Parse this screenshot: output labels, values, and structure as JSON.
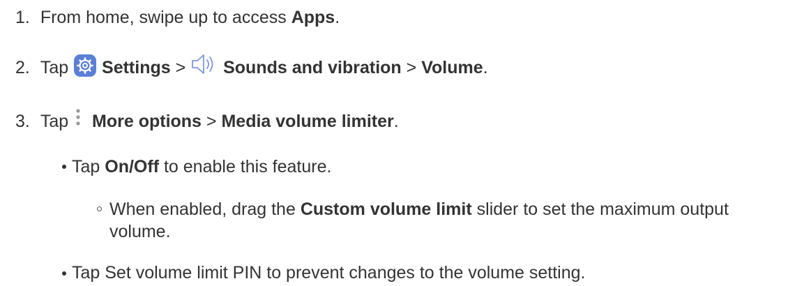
{
  "steps": [
    {
      "number": "1.",
      "text_a": "From home, swipe up to access ",
      "bold_a": "Apps",
      "text_b": "."
    },
    {
      "number": "2.",
      "text_a": "Tap ",
      "icon_a": "settings-gear-icon",
      "bold_a": "Settings",
      "text_b": " > ",
      "icon_b": "speaker-volume-icon",
      "bold_b": "Sounds and vibration",
      "text_c": " > ",
      "bold_c": "Volume",
      "text_d": "."
    },
    {
      "number": "3.",
      "text_a": "Tap ",
      "icon_a": "more-options-vertical-dots-icon",
      "bold_a": "More options",
      "text_b": " > ",
      "bold_b": "Media volume limiter",
      "text_c": "."
    }
  ],
  "bullets": [
    {
      "text_a": "Tap ",
      "bold_a": "On/Off",
      "text_b": " to enable this feature.",
      "sub": {
        "text_a": "When enabled, drag the ",
        "bold_a": "Custom volume limit",
        "text_b": " slider to set the maximum output",
        "text_c": "volume."
      }
    },
    {
      "text_a": "Tap Set volume limit PIN to prevent changes to the volume setting."
    }
  ],
  "colors": {
    "text": "#333333",
    "settings_icon_bg": "#5b7fd8",
    "sound_icon_stroke": "#7d95e0"
  }
}
